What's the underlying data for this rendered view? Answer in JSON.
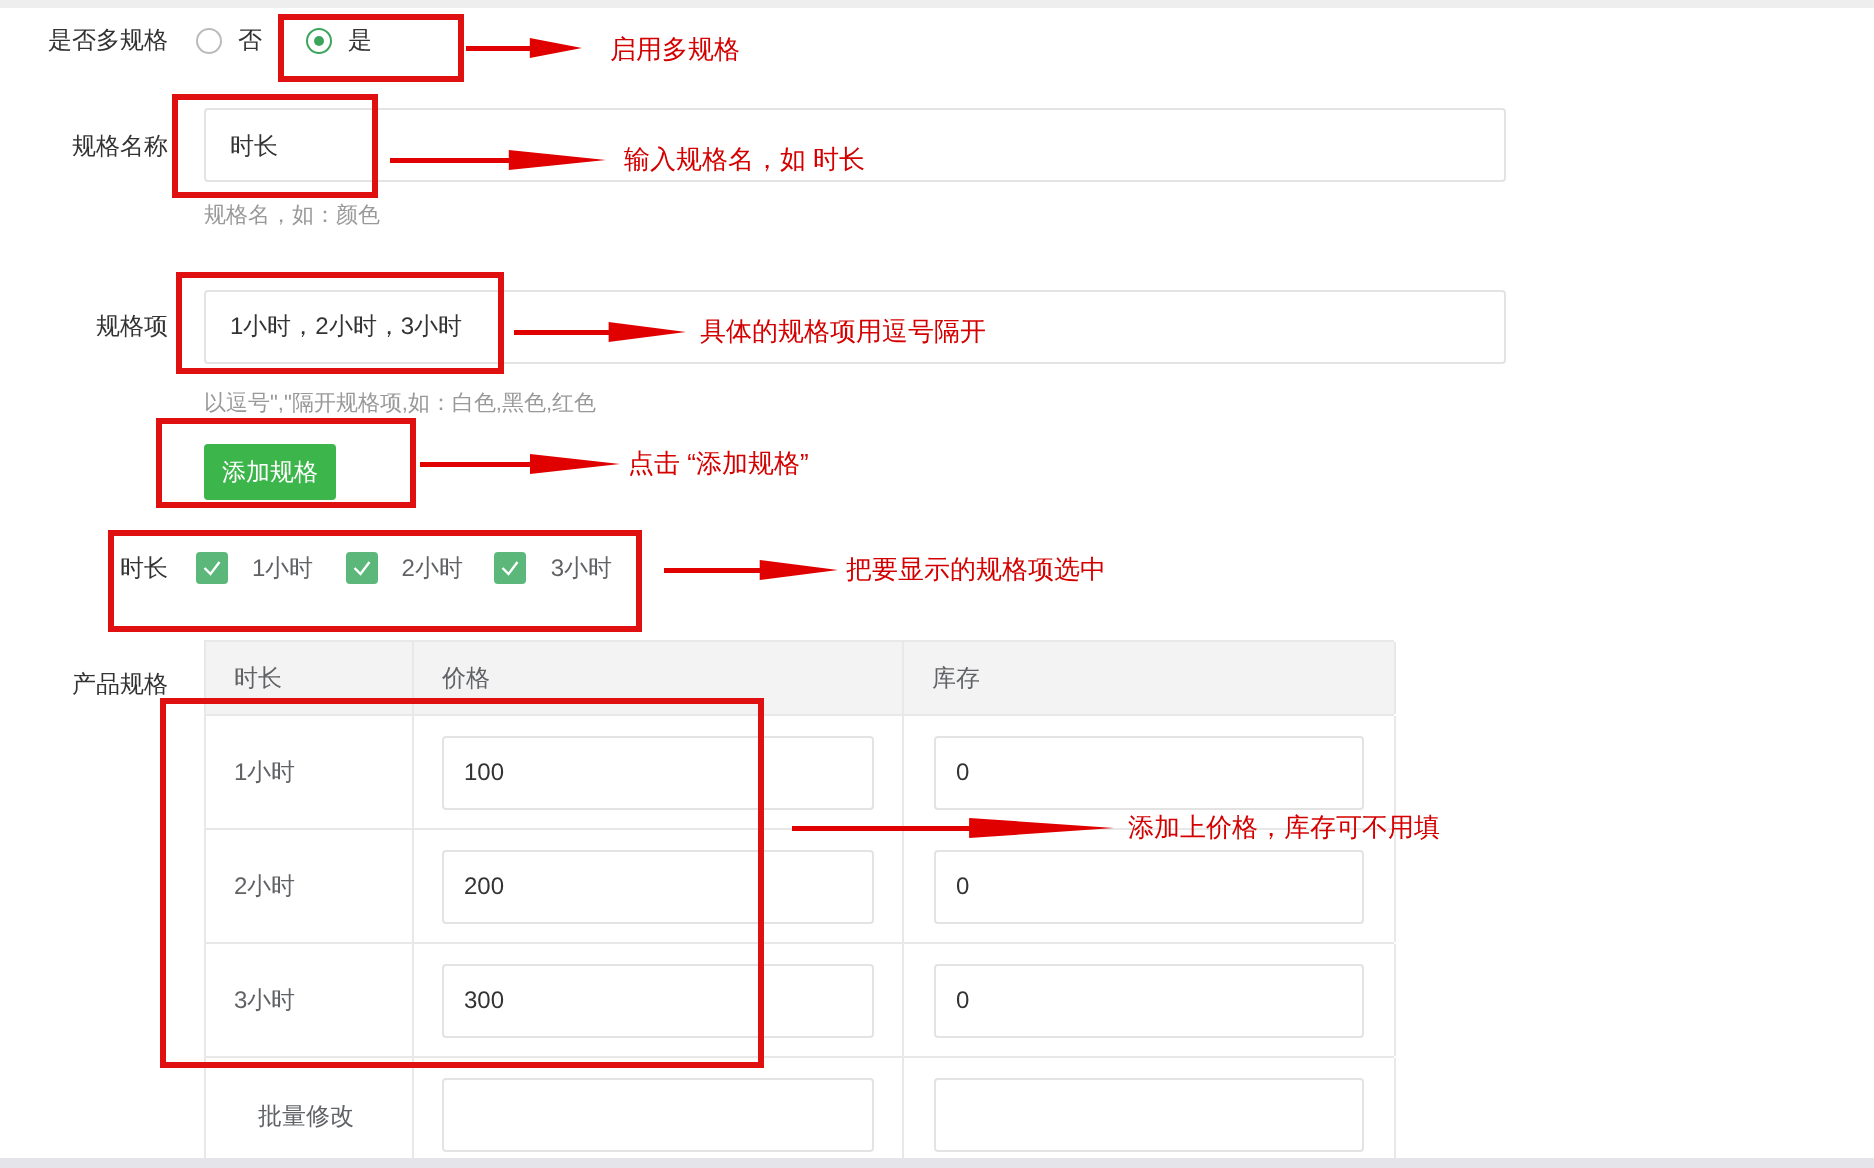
{
  "multi_spec": {
    "label": "是否多规格",
    "options": [
      {
        "label": "否",
        "selected": false
      },
      {
        "label": "是",
        "selected": true
      }
    ]
  },
  "spec_name": {
    "label": "规格名称",
    "value": "时长",
    "hint": "规格名，如：颜色"
  },
  "spec_items": {
    "label": "规格项",
    "value": "1小时，2小时，3小时",
    "hint": "以逗号\",\"隔开规格项,如：白色,黑色,红色"
  },
  "add_button": "添加规格",
  "spec_checks": {
    "label": "时长",
    "items": [
      {
        "label": "1小时",
        "checked": true
      },
      {
        "label": "2小时",
        "checked": true
      },
      {
        "label": "3小时",
        "checked": true
      }
    ]
  },
  "product_specs": {
    "label": "产品规格",
    "columns": [
      "时长",
      "价格",
      "库存"
    ],
    "rows": [
      {
        "name": "1小时",
        "price": "100",
        "stock": "0"
      },
      {
        "name": "2小时",
        "price": "200",
        "stock": "0"
      },
      {
        "name": "3小时",
        "price": "300",
        "stock": "0"
      }
    ],
    "bulk_label": "批量修改"
  },
  "annotations": [
    "启用多规格",
    "输入规格名，如 时长",
    "具体的规格项用逗号隔开",
    "点击 “添加规格”",
    "把要显示的规格项选中",
    "添加上价格，库存可不用填"
  ]
}
